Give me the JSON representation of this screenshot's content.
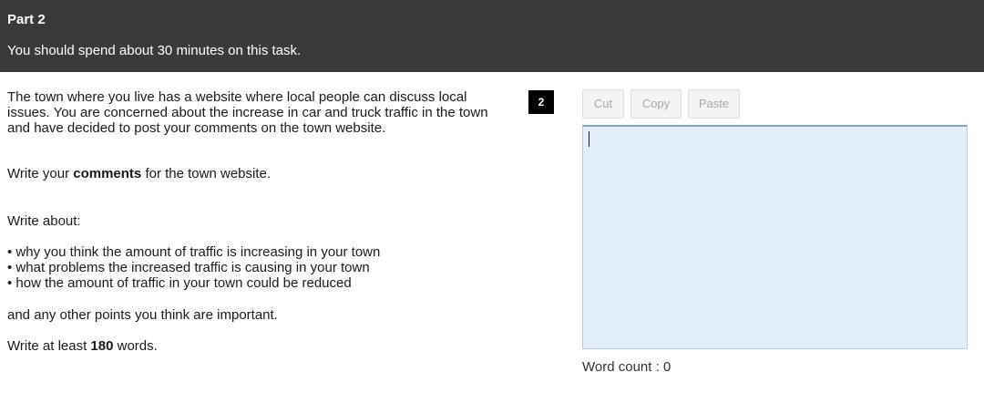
{
  "header": {
    "part_title": "Part 2",
    "instruction": "You should spend about 30 minutes on this task."
  },
  "task": {
    "intro": "The town where you live has a website where local people can discuss local issues. You are concerned about the increase in car and truck traffic in the town and have decided to post your comments on the town website.",
    "comments_prefix": "Write your ",
    "comments_bold": "comments",
    "comments_suffix": " for the town website.",
    "write_about": "Write about:",
    "bullets": [
      "why you think the amount of traffic is increasing in your town",
      "what problems the increased traffic is causing in your town",
      "how the amount of traffic in your town could be reduced"
    ],
    "other_points": "and any other points you think are important.",
    "words_prefix": "Write at least ",
    "words_bold": "180",
    "words_suffix": " words."
  },
  "question_number": "2",
  "toolbar": {
    "cut_label": "Cut",
    "copy_label": "Copy",
    "paste_label": "Paste"
  },
  "editor": {
    "value": ""
  },
  "word_count": {
    "label": "Word count : ",
    "value": "0"
  },
  "colors": {
    "header_bg": "#3a3a3a",
    "editor_bg": "#e3eefb",
    "editor_border": "#7fa3cf",
    "badge_bg": "#000000"
  }
}
